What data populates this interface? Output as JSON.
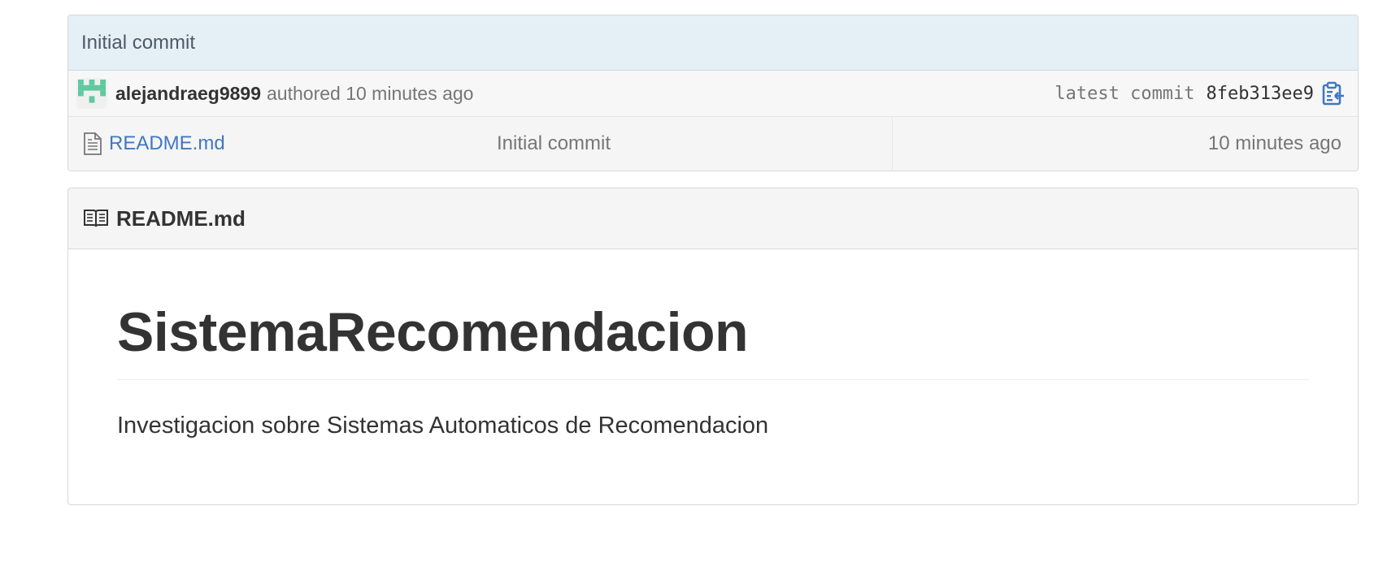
{
  "commit": {
    "title": "Initial commit",
    "author": "alejandraeg9899",
    "authored_text": "authored 10 minutes ago",
    "latest_commit_label": "latest commit",
    "sha": "8feb313ee9"
  },
  "files": [
    {
      "name": "README.md",
      "message": "Initial commit",
      "age": "10 minutes ago",
      "icon": "file-text-icon"
    }
  ],
  "readme": {
    "header_title": "README.md",
    "heading": "SistemaRecomendacion",
    "description": "Investigacion sobre Sistemas Automaticos de Recomendacion"
  },
  "colors": {
    "link": "#4078c0",
    "commit_bar": "#e5eff6",
    "avatar_green": "#5fc9a0",
    "muted_text": "#767676"
  }
}
